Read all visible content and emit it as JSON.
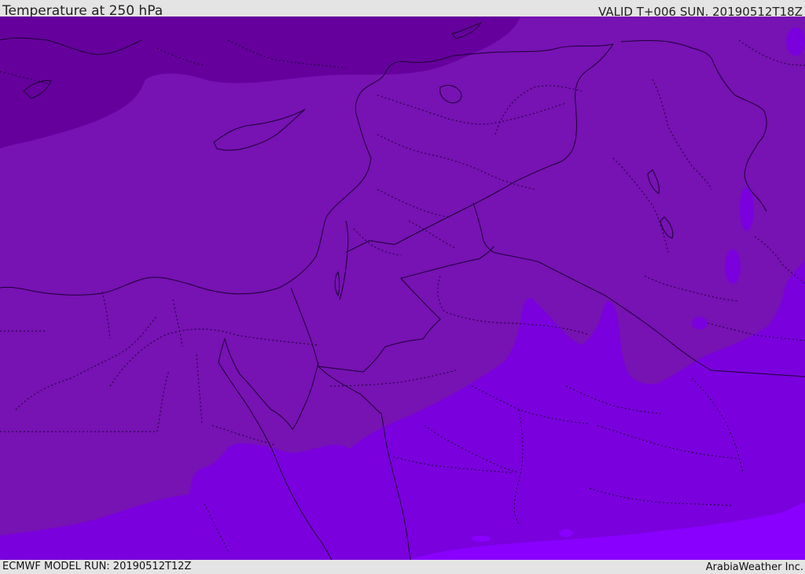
{
  "header": {
    "title": "Temperature at 250 hPa",
    "valid": "VALID T+006 SUN. 20190512T18Z"
  },
  "footer": {
    "model_run": "ECMWF MODEL RUN: 20190512T12Z",
    "credit": "ArabiaWeather Inc."
  },
  "colors": {
    "cold_band": "#65009c",
    "mid_band": "#7712b3",
    "warm_band": "#7a00dd",
    "warmest_band": "#8a00ff",
    "border_line": "#1a0033"
  }
}
